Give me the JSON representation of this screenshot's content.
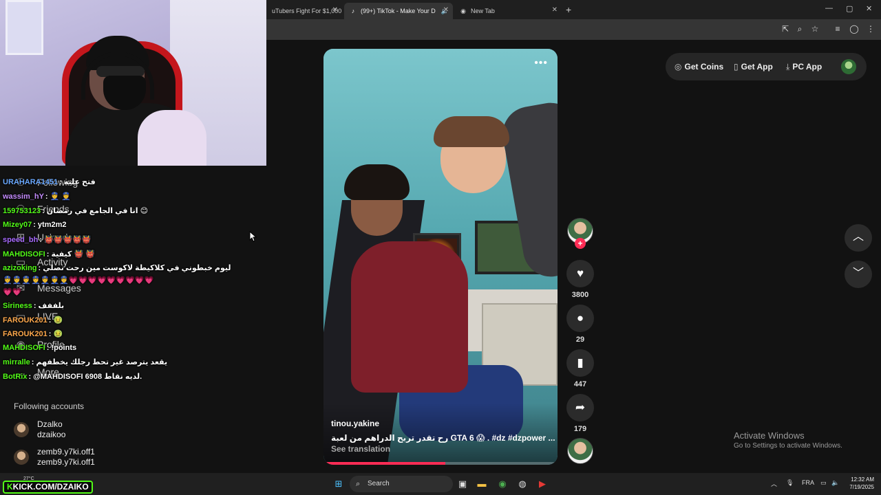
{
  "browser": {
    "tabs": [
      {
        "title": "uTubers Fight For $1,000",
        "active": false
      },
      {
        "title": "(99+) TikTok - Make Your D",
        "active": true
      },
      {
        "title": "New Tab",
        "active": false
      }
    ],
    "new_tab_label": "+"
  },
  "left_nav": {
    "items": [
      {
        "label": "Following"
      },
      {
        "label": "Friends"
      },
      {
        "label": "Upload"
      },
      {
        "label": "Activity"
      },
      {
        "label": "Messages"
      },
      {
        "label": "LIVE"
      },
      {
        "label": "Profile"
      },
      {
        "label": "More"
      }
    ],
    "following_title": "Following accounts",
    "following": [
      {
        "display": "Dzalko",
        "handle": "dzaikoo"
      },
      {
        "display": "zemb9.y7ki.off1",
        "handle": "zemb9.y7ki.off1"
      }
    ]
  },
  "chat": [
    {
      "user": "URAHARA1451",
      "color": "#6aa8ff",
      "msg": ": فتح عليه"
    },
    {
      "user": "wassim_hY",
      "color": "#c58cff",
      "msg": ": 👮 👮"
    },
    {
      "user": "159753123",
      "color": "#53fc18",
      "msg": ": انا في الجامع في رمضان 😊"
    },
    {
      "user": "Mizey07",
      "color": "#53fc18",
      "msg": ": ytm2m2"
    },
    {
      "user": "speed_bh",
      "color": "#a86bff",
      "msg": ": 👹👹👹👹👹"
    },
    {
      "user": "MAHDISOFI",
      "color": "#53fc18",
      "msg": ": كيفية 👹 👹"
    },
    {
      "user": "azizoking",
      "color": "#53fc18",
      "msg": ": ليوم خبطوني في كلاكيطة لاكوست مين رحت نصلي"
    },
    {
      "user": "",
      "color": "#ffffff",
      "msg": "👮👮👮👮👮👮👮💗💗💗💗💗💗💗💗💗"
    },
    {
      "user": "",
      "color": "#ffffff",
      "msg": "💗💗"
    },
    {
      "user": "Siriness",
      "color": "#53fc18",
      "msg": ": بلففف"
    },
    {
      "user": "FAROUK201",
      "color": "#ffa94d",
      "msg": ": 🤢"
    },
    {
      "user": "FAROUK201",
      "color": "#ffa94d",
      "msg": ": 🤢"
    },
    {
      "user": "MAHDISOFI",
      "color": "#53fc18",
      "msg": ": !points"
    },
    {
      "user": "mirralle",
      "color": "#53fc18",
      "msg": ": يقعد يترصد غير تحط رجلك يخطفهم"
    },
    {
      "user": "BotRix",
      "color": "#53fc18",
      "msg": ": @MAHDISOFI 6908 لديه نقاط."
    }
  ],
  "video": {
    "username": "tinou.yakine",
    "caption": "رح تقدر تربح الدراهم من لعبة GTA 6 😱  . #dz  #dzpower  ... more",
    "translate": "See translation",
    "progress_pct": 52
  },
  "actions": {
    "likes": "3800",
    "comments": "29",
    "saves": "447",
    "shares": "179"
  },
  "topbar": {
    "coins": "Get Coins",
    "app": "Get App",
    "pc_app": "PC App"
  },
  "watermark": {
    "line1": "Activate Windows",
    "line2": "Go to Settings to activate Windows."
  },
  "overlay": {
    "kick_prefix": "K",
    "kick_text": "KICK.COM/DZAIKO",
    "temp": "27°C"
  },
  "taskbar": {
    "search": "Search",
    "lang": "FRA",
    "time": "12:32 AM",
    "date": "7/19/2025"
  }
}
